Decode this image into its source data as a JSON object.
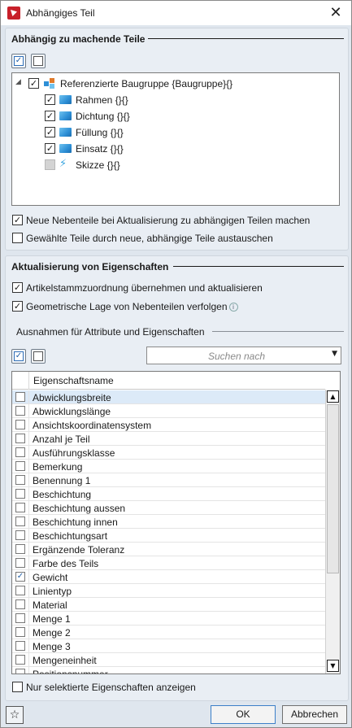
{
  "window": {
    "title": "Abhängiges Teil",
    "close_glyph": "✕"
  },
  "section1": {
    "title": "Abhängig zu machende Teile",
    "tree": {
      "root": {
        "label": "Referenzierte Baugruppe {Baugruppe}{}",
        "checked": true,
        "expander": "◢"
      },
      "children": [
        {
          "label": "Rahmen {}{}",
          "checked": true,
          "icon": "part-icon"
        },
        {
          "label": "Dichtung {}{}",
          "checked": true,
          "icon": "part-icon"
        },
        {
          "label": "Füllung {}{}",
          "checked": true,
          "icon": "part-icon"
        },
        {
          "label": "Einsatz {}{}",
          "checked": true,
          "icon": "part-icon"
        },
        {
          "label": "Skizze {}{}",
          "checked": false,
          "icon": "sketch-icon"
        }
      ]
    },
    "options": [
      {
        "label": "Neue Nebenteile bei Aktualisierung zu abhängigen Teilen machen",
        "checked": true
      },
      {
        "label": "Gewählte Teile durch neue, abhängige Teile austauschen",
        "checked": false
      }
    ]
  },
  "section2": {
    "title": "Aktualisierung von Eigenschaften",
    "options": [
      {
        "label": "Artikelstammzuordnung übernehmen und aktualisieren",
        "checked": true
      },
      {
        "label": "Geometrische Lage von Nebenteilen verfolgen",
        "checked": true
      }
    ],
    "info_glyph": "i",
    "exceptions_title": "Ausnahmen für Attribute und Eigenschaften",
    "search_placeholder": "Suchen nach",
    "dropdown_glyph": "▼",
    "list_header": "Eigenschaftsname",
    "rows": [
      {
        "label": "Abwicklungsbreite",
        "checked": false,
        "selected": true
      },
      {
        "label": "Abwicklungslänge",
        "checked": false
      },
      {
        "label": "Ansichtskoordinatensystem",
        "checked": false
      },
      {
        "label": "Anzahl je Teil",
        "checked": false
      },
      {
        "label": "Ausführungsklasse",
        "checked": false
      },
      {
        "label": "Bemerkung",
        "checked": false
      },
      {
        "label": "Benennung 1",
        "checked": false
      },
      {
        "label": "Beschichtung",
        "checked": false
      },
      {
        "label": "Beschichtung aussen",
        "checked": false
      },
      {
        "label": "Beschichtung innen",
        "checked": false
      },
      {
        "label": "Beschichtungsart",
        "checked": false
      },
      {
        "label": "Ergänzende Toleranz",
        "checked": false
      },
      {
        "label": "Farbe des Teils",
        "checked": false
      },
      {
        "label": "Gewicht",
        "checked": true
      },
      {
        "label": "Linientyp",
        "checked": false
      },
      {
        "label": "Material",
        "checked": false
      },
      {
        "label": "Menge 1",
        "checked": false
      },
      {
        "label": "Menge 2",
        "checked": false
      },
      {
        "label": "Menge 3",
        "checked": false
      },
      {
        "label": "Mengeneinheit",
        "checked": false
      },
      {
        "label": "Positionsnummer",
        "checked": false
      }
    ],
    "scroll_up": "▲",
    "scroll_down": "▼",
    "show_selected_label": "Nur selektierte Eigenschaften anzeigen"
  },
  "footer": {
    "favorite_glyph": "☆",
    "ok_label": "OK",
    "cancel_label": "Abbrechen"
  }
}
